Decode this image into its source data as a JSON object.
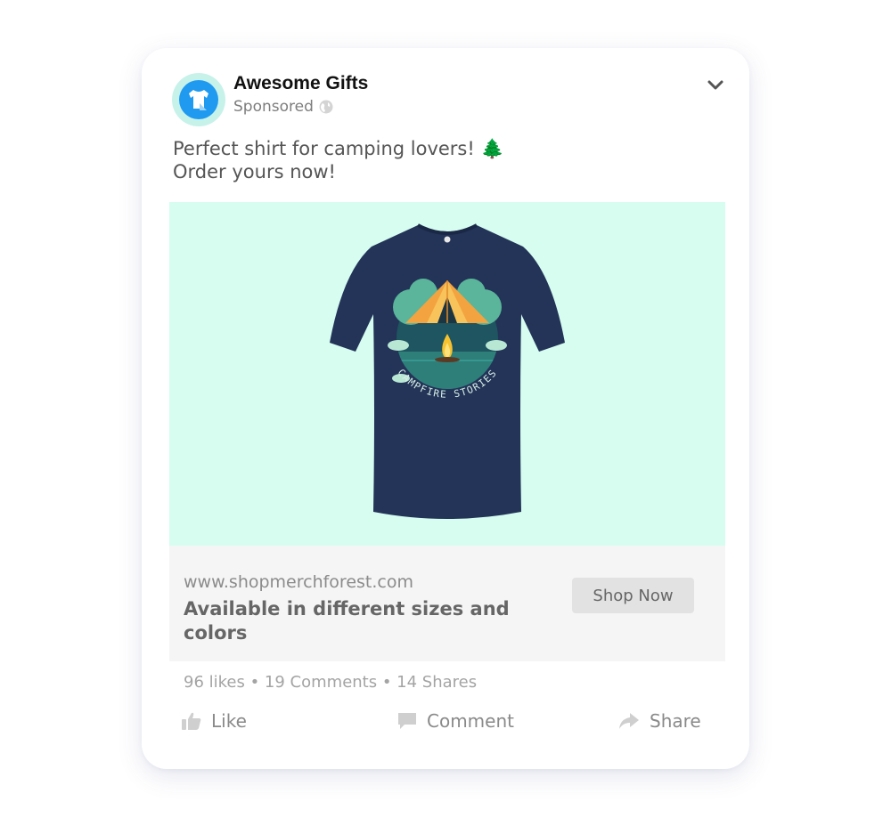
{
  "post": {
    "page_name": "Awesome Gifts",
    "sponsored": "Sponsored",
    "caption_line1": "Perfect shirt for camping lovers! 🌲",
    "caption_line2": "Order yours now!",
    "shirt_print_text": "CAMPFIRE STORIES",
    "link_domain": "www.shopmerchforest.com",
    "link_headline": "Available in different sizes and colors",
    "cta_label": "Shop Now",
    "stats": "96 likes • 19 Comments • 14 Shares"
  },
  "actions": {
    "like": "Like",
    "comment": "Comment",
    "share": "Share"
  },
  "icons": {
    "avatar": "tshirt-icon",
    "audience": "globe-icon",
    "menu": "chevron-down-icon",
    "like": "thumbs-up-icon",
    "comment": "comment-icon",
    "share": "share-icon"
  },
  "colors": {
    "media_background": "#d6fdf0",
    "avatar_ring": "#c7f2ea",
    "avatar_fill": "#1f9af0",
    "shirt": "#233458"
  }
}
